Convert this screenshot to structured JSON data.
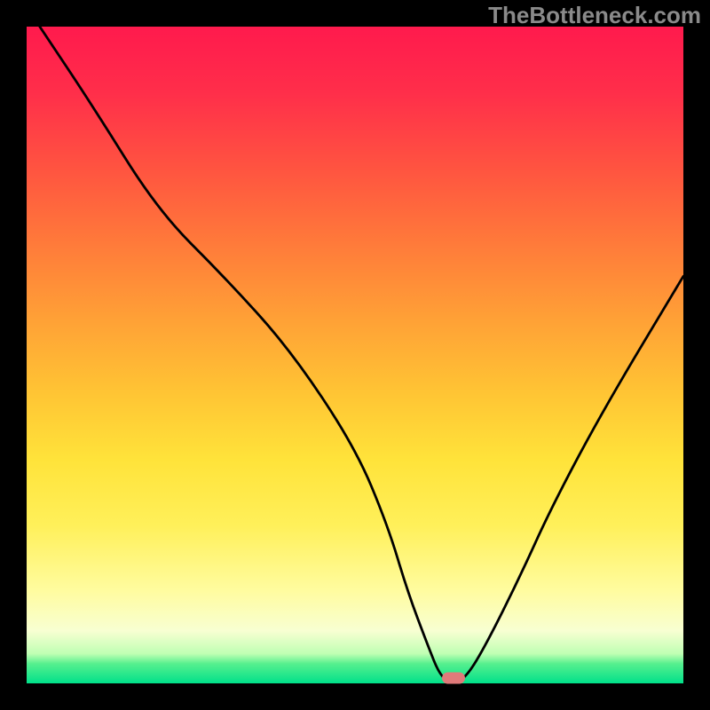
{
  "watermark": "TheBottleneck.com",
  "chart_data": {
    "type": "line",
    "title": "",
    "xlabel": "",
    "ylabel": "",
    "xlim": [
      0,
      100
    ],
    "ylim": [
      0,
      100
    ],
    "grid": false,
    "series": [
      {
        "name": "bottleneck-curve",
        "x": [
          2,
          10,
          20,
          30,
          40,
          50,
          55,
          58,
          61,
          63,
          65,
          67,
          70,
          75,
          80,
          88,
          100
        ],
        "values": [
          100,
          88,
          72,
          62,
          51,
          36,
          24,
          14,
          6,
          1,
          0,
          1,
          6,
          16,
          27,
          42,
          62
        ]
      }
    ],
    "annotations": [
      {
        "name": "optimal-marker",
        "x": 65,
        "y": 0.8
      }
    ],
    "gradient_colors": {
      "top": "#ff1a4d",
      "upper_mid": "#ffa236",
      "mid": "#ffe33a",
      "lower": "#fffca0",
      "bottom": "#00e08a"
    },
    "curve_color": "#000000",
    "marker_color": "#e07a7a"
  }
}
